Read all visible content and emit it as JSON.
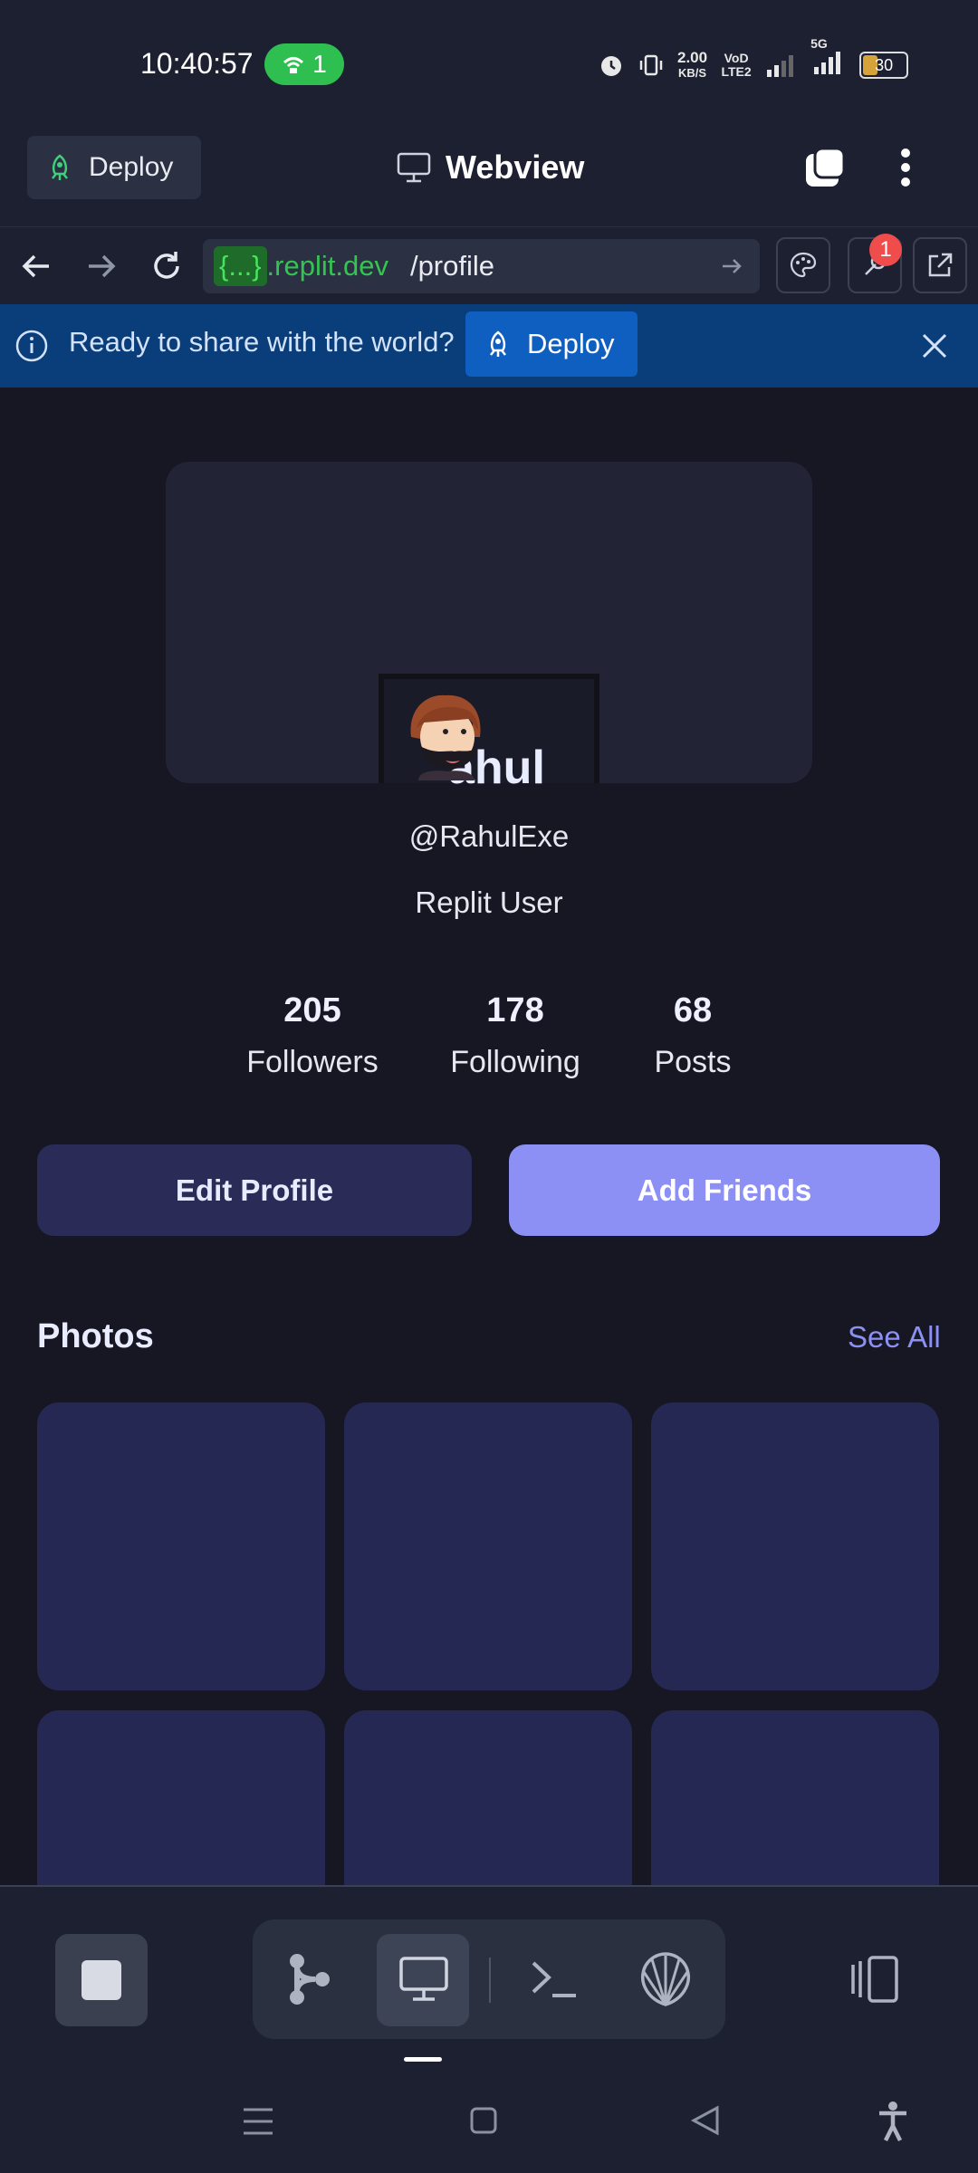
{
  "status_bar": {
    "time": "10:40:57",
    "hotspot_count": "1",
    "net_speed_value": "2.00",
    "net_speed_unit": "KB/S",
    "volte": "VoD LTE2",
    "network": "5G",
    "battery": "30"
  },
  "header": {
    "deploy_label": "Deploy",
    "title": "Webview"
  },
  "url_bar": {
    "host_badge": "{...}",
    "host": ".replit.dev",
    "path": "/profile",
    "notification_count": "1"
  },
  "banner": {
    "message": "Ready to share with the world?",
    "deploy_label": "Deploy"
  },
  "profile": {
    "name_partial": "ahul",
    "handle": "@RahulExe",
    "subtitle": "Replit User",
    "stats": [
      {
        "value": "205",
        "label": "Followers"
      },
      {
        "value": "178",
        "label": "Following"
      },
      {
        "value": "68",
        "label": "Posts"
      }
    ],
    "edit_label": "Edit Profile",
    "add_label": "Add Friends",
    "photos_title": "Photos",
    "see_all": "See All"
  },
  "colors": {
    "accent": "#8c90f4",
    "button_dark": "#2a2c57",
    "banner_bg": "#0a3e7b",
    "photo_tile": "#262854"
  }
}
